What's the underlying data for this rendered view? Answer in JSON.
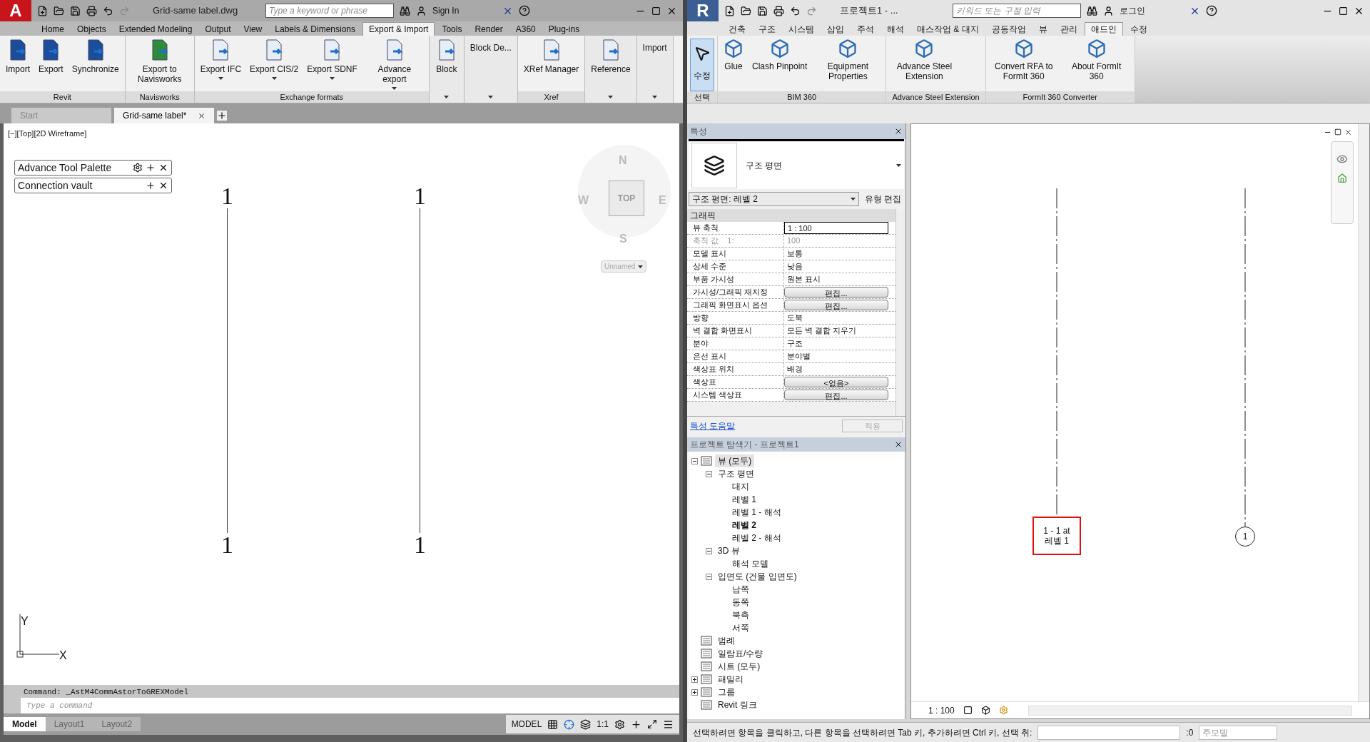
{
  "autocad": {
    "app_letter": "A",
    "title": "Grid-same label.dwg",
    "search": {
      "placeholder": "Type a keyword or phrase"
    },
    "sign_in": "Sign In",
    "ribbon_tabs": [
      {
        "label": "Home",
        "selected": false
      },
      {
        "label": "Objects",
        "selected": false
      },
      {
        "label": "Extended Modeling",
        "selected": false
      },
      {
        "label": "Output",
        "selected": false
      },
      {
        "label": "View",
        "selected": false
      },
      {
        "label": "Labels & Dimensions",
        "selected": false
      },
      {
        "label": "Export & Import",
        "selected": true
      },
      {
        "label": "Tools",
        "selected": false
      },
      {
        "label": "Render",
        "selected": false
      },
      {
        "label": "A360",
        "selected": false
      },
      {
        "label": "Plug-ins",
        "selected": false
      }
    ],
    "panels": [
      {
        "title": "Revit",
        "buttons": [
          {
            "label": "Import",
            "kind": "large",
            "dropdown": false
          },
          {
            "label": "Export",
            "kind": "large",
            "dropdown": false
          },
          {
            "label": "Synchronize",
            "kind": "large",
            "dropdown": false
          }
        ]
      },
      {
        "title": "Navisworks",
        "buttons": [
          {
            "label": "Export to Navisworks",
            "kind": "large",
            "dropdown": false
          }
        ]
      },
      {
        "title": "Exchange formats",
        "buttons": [
          {
            "label": "Export IFC",
            "kind": "large",
            "dropdown": true
          },
          {
            "label": "Export CIS/2",
            "kind": "large",
            "dropdown": true
          },
          {
            "label": "Export SDNF",
            "kind": "large",
            "dropdown": true
          },
          {
            "label": "Advance export",
            "kind": "large",
            "dropdown": true
          }
        ]
      },
      {
        "buttons": [
          {
            "label": "Block",
            "kind": "large",
            "dropdown": false
          }
        ]
      },
      {
        "buttons": [
          {
            "label": "Block De...",
            "kind": "text",
            "dropdown": false
          }
        ]
      },
      {
        "title": "Xref",
        "buttons": [
          {
            "label": "XRef Manager",
            "kind": "large",
            "dropdown": false
          }
        ]
      },
      {
        "buttons": [
          {
            "label": "Reference",
            "kind": "large",
            "dropdown": false
          }
        ]
      },
      {
        "buttons": [
          {
            "label": "Import",
            "kind": "text",
            "dropdown": false
          }
        ]
      }
    ],
    "file_tabs": [
      {
        "label": "Start",
        "selected": false
      },
      {
        "label": "Grid-same label*",
        "selected": true
      }
    ],
    "viewport_label": "[−][Top][2D Wireframe]",
    "palettes": [
      {
        "label": "Advance Tool Palette",
        "settings": true
      },
      {
        "label": "Connection vault",
        "settings": false
      }
    ],
    "viewcube": {
      "north": "N",
      "south": "S",
      "east": "E",
      "west": "W",
      "face": "TOP",
      "ucs": "Unnamed"
    },
    "grid_lines": [
      {
        "top_label": "1",
        "bottom_label": "1"
      },
      {
        "top_label": "1",
        "bottom_label": "1"
      }
    ],
    "axes": {
      "y": "Y",
      "x": "X"
    },
    "command_history": "Command: _AstM4CommAstorToGREXModel",
    "command": {
      "placeholder": "Type a command"
    },
    "layout_tabs": [
      {
        "label": "Model",
        "selected": true
      },
      {
        "label": "Layout1",
        "selected": false
      },
      {
        "label": "Layout2",
        "selected": false
      }
    ],
    "status": {
      "space": "MODEL",
      "scale": "1:1"
    }
  },
  "revit": {
    "app_letter": "R",
    "title": "프로젝트1 - ...",
    "search": {
      "placeholder": "키워드 또는 구절 입력"
    },
    "sign_in": "로그인",
    "ribbon_tabs": [
      {
        "label": "건축",
        "selected": false
      },
      {
        "label": "구조",
        "selected": false
      },
      {
        "label": "시스템",
        "selected": false
      },
      {
        "label": "삽입",
        "selected": false
      },
      {
        "label": "주석",
        "selected": false
      },
      {
        "label": "해석",
        "selected": false
      },
      {
        "label": "매스작업 & 대지",
        "selected": false
      },
      {
        "label": "공동작업",
        "selected": false
      },
      {
        "label": "뷰",
        "selected": false
      },
      {
        "label": "관리",
        "selected": false
      },
      {
        "label": "애드인",
        "selected": true
      },
      {
        "label": "수정",
        "selected": false
      }
    ],
    "panels": [
      {
        "title": "선택",
        "buttons": [
          {
            "label": "수정",
            "selected": true
          }
        ]
      },
      {
        "title": "BIM 360",
        "buttons": [
          {
            "label": "Glue",
            "selected": false
          },
          {
            "label": "Clash Pinpoint",
            "selected": false
          },
          {
            "label": "Equipment Properties",
            "selected": false
          }
        ]
      },
      {
        "title": "Advance Steel Extension",
        "buttons": [
          {
            "label": "Advance Steel Extension",
            "selected": false
          }
        ]
      },
      {
        "title": "FormIt 360 Converter",
        "buttons": [
          {
            "label": "Convert RFA to FormIt 360",
            "selected": false
          },
          {
            "label": "About FormIt 360",
            "selected": false
          }
        ]
      }
    ],
    "properties": {
      "title": "특성",
      "type_name": "구조 평면",
      "instance": "구조 평면: 레벨 2",
      "edit_type": "유형 편집",
      "group": "그래픽",
      "rows": [
        {
          "label": "뷰 축척",
          "value": "1 : 100",
          "kind": "input",
          "disabled": false
        },
        {
          "label": "축척 값    1:",
          "value": "100",
          "kind": "text",
          "disabled": true
        },
        {
          "label": "모델 표시",
          "value": "보통",
          "kind": "text",
          "disabled": false
        },
        {
          "label": "상세 수준",
          "value": "낮음",
          "kind": "text",
          "disabled": false
        },
        {
          "label": "부품 가시성",
          "value": "원본 표시",
          "kind": "text",
          "disabled": false
        },
        {
          "label": "가시성/그래픽 재지정",
          "value": "편집...",
          "kind": "button",
          "disabled": false
        },
        {
          "label": "그래픽 화면표시 옵션",
          "value": "편집...",
          "kind": "button",
          "disabled": false
        },
        {
          "label": "방향",
          "value": "도북",
          "kind": "text",
          "disabled": false
        },
        {
          "label": "벽 결합 화면표시",
          "value": "모든 벽 결합 지우기",
          "kind": "text",
          "disabled": false
        },
        {
          "label": "분야",
          "value": "구조",
          "kind": "text",
          "disabled": false
        },
        {
          "label": "은선 표시",
          "value": "분야별",
          "kind": "text",
          "disabled": false
        },
        {
          "label": "색상표 위치",
          "value": "배경",
          "kind": "text",
          "disabled": false
        },
        {
          "label": "색상표",
          "value": "<없음>",
          "kind": "button",
          "disabled": false
        },
        {
          "label": "시스템 색상표",
          "value": "편집...",
          "kind": "button",
          "disabled": false
        }
      ],
      "help_link": "특성 도움말",
      "apply": "적용"
    },
    "browser": {
      "title": "프로젝트 탐색기 - 프로젝트1",
      "tree": [
        {
          "label": "뷰 (모두)",
          "selected": true,
          "current": false,
          "expanded": true,
          "children": [
            {
              "label": "구조 평면",
              "selected": false,
              "current": false,
              "expanded": true,
              "children": [
                {
                  "label": "대지",
                  "selected": false,
                  "current": false
                },
                {
                  "label": "레벨 1",
                  "selected": false,
                  "current": false
                },
                {
                  "label": "레벨 1 - 해석",
                  "selected": false,
                  "current": false
                },
                {
                  "label": "레벨 2",
                  "selected": false,
                  "current": true
                },
                {
                  "label": "레벨 2 - 해석",
                  "selected": false,
                  "current": false
                }
              ]
            },
            {
              "label": "3D 뷰",
              "selected": false,
              "current": false,
              "expanded": true,
              "children": [
                {
                  "label": "해석 모델",
                  "selected": false,
                  "current": false
                }
              ]
            },
            {
              "label": "입면도 (건물 입면도)",
              "selected": false,
              "current": false,
              "expanded": true,
              "children": [
                {
                  "label": "남쪽",
                  "selected": false,
                  "current": false
                },
                {
                  "label": "동쪽",
                  "selected": false,
                  "current": false
                },
                {
                  "label": "북측",
                  "selected": false,
                  "current": false
                },
                {
                  "label": "서쪽",
                  "selected": false,
                  "current": false
                }
              ]
            }
          ]
        },
        {
          "label": "범례",
          "selected": false,
          "current": false
        },
        {
          "label": "일람표/수량",
          "selected": false,
          "current": false
        },
        {
          "label": "시트 (모두)",
          "selected": false,
          "current": false
        },
        {
          "label": "패밀리",
          "selected": false,
          "current": false,
          "expanded": false
        },
        {
          "label": "그룹",
          "selected": false,
          "current": false,
          "expanded": false
        },
        {
          "label": "Revit 링크",
          "selected": false,
          "current": false
        }
      ]
    },
    "canvas": {
      "grid_tags": [
        {
          "label": "1 - 1 at 레벨 1",
          "highlighted": true
        },
        {
          "label": "1",
          "highlighted": false
        }
      ],
      "scale": "1 : 100"
    },
    "status": {
      "message": "선택하려면 항목을 클릭하고, 다른 항목을 선택하려면 Tab 키, 추가하려면 Ctrl 키, 선택 취:",
      "count": ":0",
      "model": "주모델"
    }
  }
}
